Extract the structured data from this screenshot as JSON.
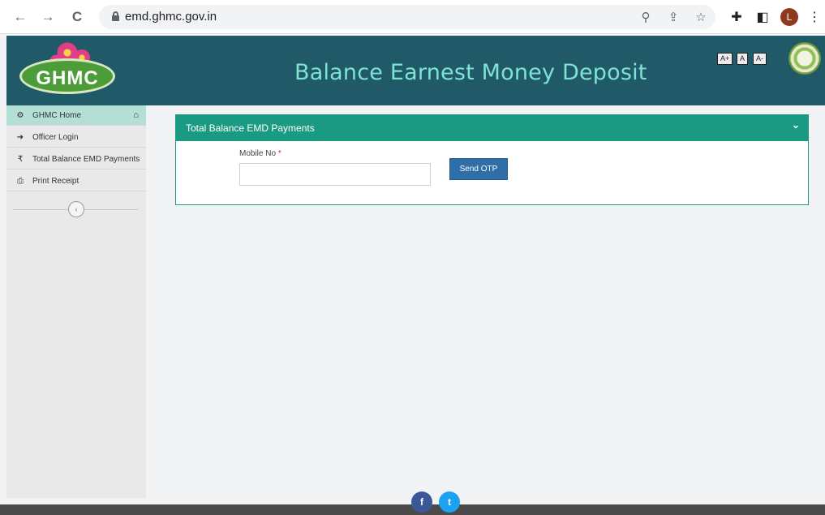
{
  "browser": {
    "url": "emd.ghmc.gov.in",
    "profile_initial": "L",
    "back_glyph": "←",
    "forward_glyph": "→",
    "reload_glyph": "C",
    "zoom_glyph": "⚲",
    "share_glyph": "⇪",
    "star_glyph": "☆",
    "extensions_glyph": "✚",
    "sidepanel_glyph": "◧",
    "menu_glyph": "⋮"
  },
  "header": {
    "logo_text": "GHMC",
    "title": "Balance Earnest Money Deposit",
    "font_controls": [
      "A+",
      "A",
      "A-"
    ]
  },
  "sidebar": {
    "items": [
      {
        "icon": "⚙",
        "label": "GHMC Home",
        "icon_name": "dashboard-icon"
      },
      {
        "icon": "➜",
        "label": "Officer Login",
        "icon_name": "sign-in-icon"
      },
      {
        "icon": "₹",
        "label": "Total Balance EMD Payments",
        "icon_name": "rupee-icon"
      },
      {
        "icon": "⎙",
        "label": "Print Receipt",
        "icon_name": "print-icon"
      }
    ],
    "home_glyph": "⌂",
    "collapse_glyph": "‹"
  },
  "panel": {
    "title": "Total Balance EMD Payments",
    "chevron": "⌄",
    "mobile_label": "Mobile No",
    "required_mark": "*",
    "mobile_value": "",
    "mobile_placeholder": "",
    "send_otp_label": "Send OTP"
  },
  "footer": {
    "facebook": "f",
    "twitter": "t"
  },
  "colors": {
    "header_bg": "#205a69",
    "title_color": "#7fe3d3",
    "panel_accent": "#1a9a83",
    "button_blue": "#2f6ea6",
    "sidebar_active": "#b3dfd5"
  }
}
